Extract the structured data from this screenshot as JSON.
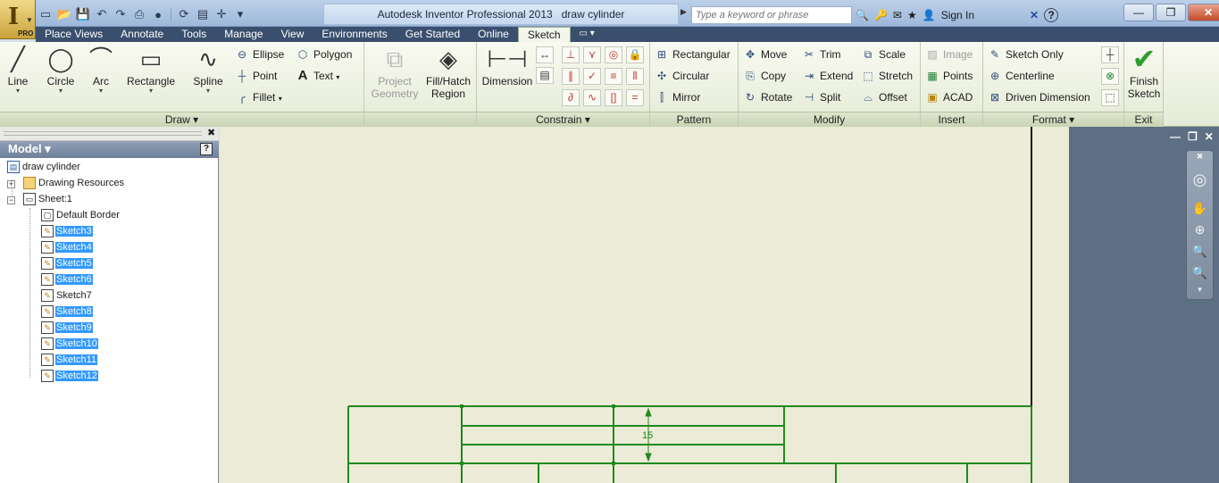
{
  "app": {
    "title": "Autodesk Inventor Professional 2013",
    "document": "draw cylinder",
    "edition_badge": "PRO",
    "search_placeholder": "Type a keyword or phrase",
    "sign_in": "Sign In"
  },
  "tabs": [
    "Place Views",
    "Annotate",
    "Tools",
    "Manage",
    "View",
    "Environments",
    "Get Started",
    "Online",
    "Sketch"
  ],
  "active_tab": "Sketch",
  "ribbon": {
    "draw": {
      "label": "Draw",
      "big": [
        "Line",
        "Circle",
        "Arc",
        "Rectangle",
        "Spline"
      ],
      "small": [
        "Ellipse",
        "Point",
        "Fillet",
        "Polygon",
        "Text"
      ]
    },
    "project_geometry": "Project Geometry",
    "fill_hatch": "Fill/Hatch Region",
    "constrain": {
      "label": "Constrain",
      "dimension": "Dimension"
    },
    "pattern": {
      "label": "Pattern",
      "items": [
        "Rectangular",
        "Circular",
        "Mirror"
      ]
    },
    "modify": {
      "label": "Modify",
      "items": [
        "Move",
        "Copy",
        "Rotate",
        "Trim",
        "Extend",
        "Split",
        "Scale",
        "Stretch",
        "Offset"
      ]
    },
    "insert": {
      "label": "Insert",
      "items": [
        "Image",
        "Points",
        "ACAD"
      ]
    },
    "format": {
      "label": "Format",
      "items": [
        "Sketch Only",
        "Centerline",
        "Driven Dimension"
      ]
    },
    "exit": {
      "label": "Exit",
      "finish": "Finish Sketch"
    }
  },
  "browser": {
    "title": "Model",
    "root": "draw cylinder",
    "drawing_resources": "Drawing Resources",
    "sheet": "Sheet:1",
    "default_border": "Default Border",
    "sketches": [
      {
        "name": "Sketch3",
        "selected": true
      },
      {
        "name": "Sketch4",
        "selected": true
      },
      {
        "name": "Sketch5",
        "selected": true
      },
      {
        "name": "Sketch6",
        "selected": true
      },
      {
        "name": "Sketch7",
        "selected": false
      },
      {
        "name": "Sketch8",
        "selected": true
      },
      {
        "name": "Sketch9",
        "selected": true
      },
      {
        "name": "Sketch10",
        "selected": true
      },
      {
        "name": "Sketch11",
        "selected": true
      },
      {
        "name": "Sketch12",
        "selected": true
      }
    ]
  },
  "drawing": {
    "dimension_text": "15",
    "line_color": "#1f8a1f"
  },
  "colors": {
    "canvas": "#ecebd7",
    "selection": "#3399ff",
    "tabbar": "#3a4f6e"
  }
}
